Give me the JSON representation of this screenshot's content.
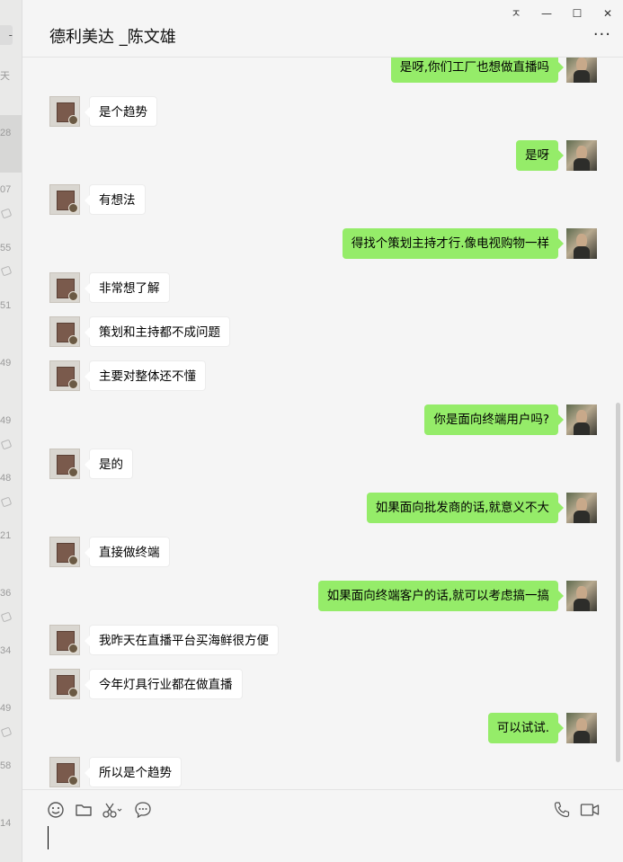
{
  "sidebar_sliver": {
    "top_label": "-",
    "top_label2": "天",
    "times": [
      "28",
      "07",
      "55",
      "51",
      "49",
      "49",
      "48",
      "21",
      "36",
      "34",
      "49",
      "58",
      "14"
    ]
  },
  "window": {
    "title": "德利美达 _陈文雄",
    "pin_glyph": "ㅈ",
    "minimize_glyph": "—",
    "maximize_glyph": "☐",
    "close_glyph": "✕",
    "more_glyph": "···"
  },
  "messages": [
    {
      "side": "out",
      "text": "是呀,你们工厂也想做直播吗"
    },
    {
      "side": "in",
      "text": "是个趋势"
    },
    {
      "side": "out",
      "text": "是呀"
    },
    {
      "side": "in",
      "text": "有想法"
    },
    {
      "side": "out",
      "text": "得找个策划主持才行.像电视购物一样"
    },
    {
      "side": "in",
      "text": "非常想了解"
    },
    {
      "side": "in",
      "text": "策划和主持都不成问题"
    },
    {
      "side": "in",
      "text": "主要对整体还不懂"
    },
    {
      "side": "out",
      "text": "你是面向终端用户吗?"
    },
    {
      "side": "in",
      "text": "是的"
    },
    {
      "side": "out",
      "text": "如果面向批发商的话,就意义不大"
    },
    {
      "side": "in",
      "text": "直接做终端"
    },
    {
      "side": "out",
      "text": "如果面向终端客户的话,就可以考虑搞一搞"
    },
    {
      "side": "in",
      "text": "我昨天在直播平台买海鲜很方便"
    },
    {
      "side": "in",
      "text": "今年灯具行业都在做直播"
    },
    {
      "side": "out",
      "text": "可以试试."
    },
    {
      "side": "in",
      "text": "所以是个趋势"
    }
  ],
  "composer": {
    "tools": [
      "emoji-icon",
      "folder-icon",
      "scissors-icon",
      "chat-history-icon",
      "phone-icon",
      "video-icon"
    ]
  },
  "colors": {
    "outgoing_bubble": "#95ec69",
    "incoming_bubble": "#ffffff",
    "background": "#f5f5f5"
  }
}
